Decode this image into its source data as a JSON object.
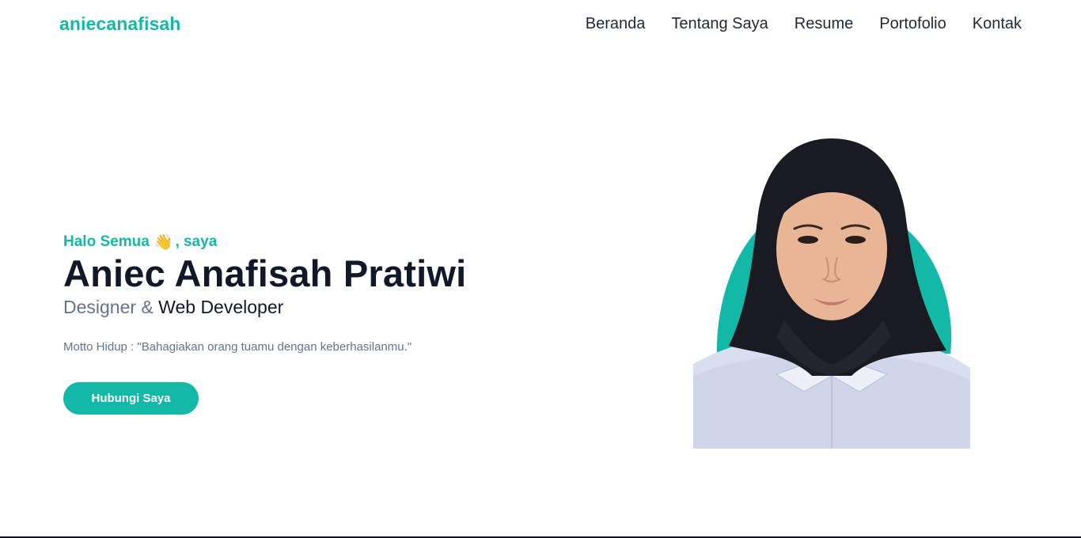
{
  "navbar": {
    "brand": "aniecanafisah",
    "links": [
      "Beranda",
      "Tentang Saya",
      "Resume",
      "Portofolio",
      "Kontak"
    ]
  },
  "hero": {
    "greeting_prefix": "Halo Semua",
    "greeting_icon": "waving-hand-icon",
    "greeting_suffix": ", saya",
    "name": "Aniec Anafisah Pratiwi",
    "role_designer": "Designer & ",
    "role_developer": "Web Developer",
    "motto": "Motto Hidup : \"Bahagiakan orang tuamu dengan keberhasilanmu.\"",
    "cta_label": "Hubungi Saya"
  },
  "colors": {
    "accent": "#14b8a6",
    "text_dark": "#111827",
    "text_muted": "#64748b"
  }
}
